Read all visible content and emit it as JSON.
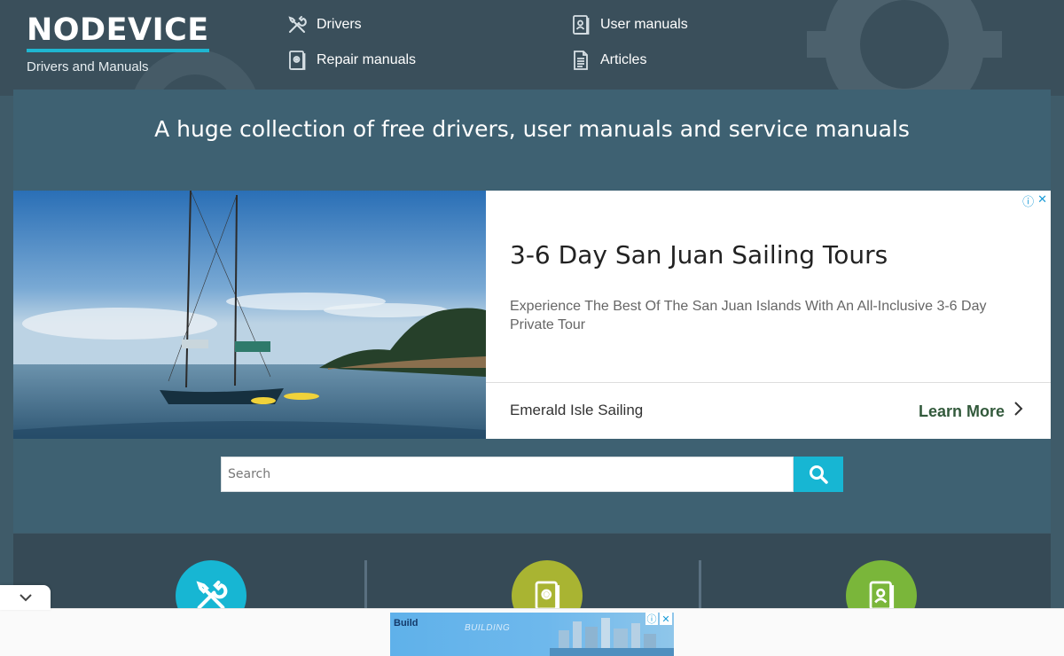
{
  "header": {
    "logo_text": "NODEVICE",
    "logo_subtitle": "Drivers and Manuals",
    "nav": [
      {
        "label": "Drivers",
        "icon": "tools-icon"
      },
      {
        "label": "User manuals",
        "icon": "user-manual-icon"
      },
      {
        "label": "Repair manuals",
        "icon": "repair-manual-icon"
      },
      {
        "label": "Articles",
        "icon": "article-icon"
      }
    ]
  },
  "main": {
    "tagline": "A huge collection of free drivers, user manuals and service manuals"
  },
  "ad": {
    "title": "3-6 Day San Juan Sailing Tours",
    "description": "Experience The Best Of The San Juan Islands With An All-Inclusive 3-6 Day Private Tour",
    "advertiser": "Emerald Isle Sailing",
    "cta": "Learn More"
  },
  "search": {
    "placeholder": "Search"
  },
  "categories": [
    {
      "name": "drivers",
      "color": "#17b6d3",
      "icon": "tools-icon"
    },
    {
      "name": "repair-manuals",
      "color": "#a9b432",
      "icon": "repair-manual-icon"
    },
    {
      "name": "user-manuals",
      "color": "#7ab63a",
      "icon": "user-manual-icon"
    }
  ],
  "bottom_ad": {
    "brand": "Build",
    "word": "BUILDING"
  },
  "colors": {
    "accent": "#17b6d3",
    "header_bg": "#3a4f5b",
    "panel_bg": "#3e6172",
    "cta_green": "#335a3c"
  }
}
